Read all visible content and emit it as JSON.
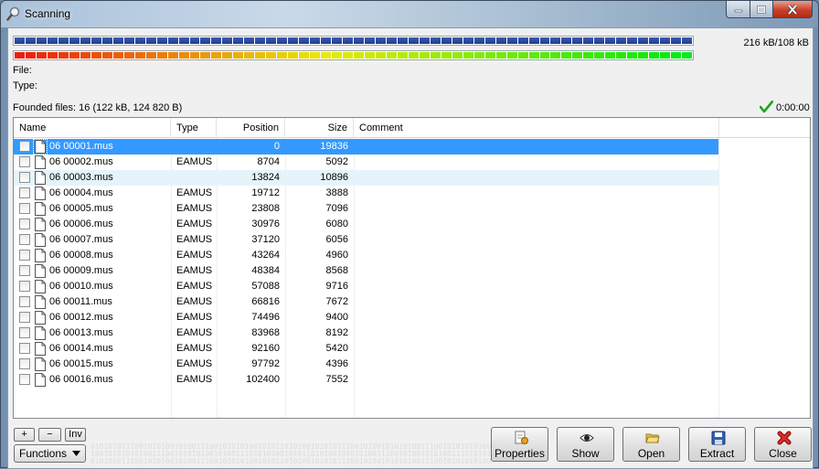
{
  "window": {
    "title": "Scanning"
  },
  "progress": {
    "text": "216 kB/108 kB",
    "fraction": 1.0
  },
  "labels": {
    "file": "File:",
    "type": "Type:"
  },
  "summary": {
    "found": "Founded files: 16 (122 kB, 124 820 B)",
    "elapsed": "0:00:00"
  },
  "table": {
    "columns": [
      "Name",
      "Type",
      "Position",
      "Size",
      "Comment"
    ],
    "rows": [
      {
        "name": "06 00001.mus",
        "type": "",
        "position": "0",
        "size": "19836"
      },
      {
        "name": "06 00002.mus",
        "type": "EAMUS",
        "position": "8704",
        "size": "5092"
      },
      {
        "name": "06 00003.mus",
        "type": "",
        "position": "13824",
        "size": "10896"
      },
      {
        "name": "06 00004.mus",
        "type": "EAMUS",
        "position": "19712",
        "size": "3888"
      },
      {
        "name": "06 00005.mus",
        "type": "EAMUS",
        "position": "23808",
        "size": "7096"
      },
      {
        "name": "06 00006.mus",
        "type": "EAMUS",
        "position": "30976",
        "size": "6080"
      },
      {
        "name": "06 00007.mus",
        "type": "EAMUS",
        "position": "37120",
        "size": "6056"
      },
      {
        "name": "06 00008.mus",
        "type": "EAMUS",
        "position": "43264",
        "size": "4960"
      },
      {
        "name": "06 00009.mus",
        "type": "EAMUS",
        "position": "48384",
        "size": "8568"
      },
      {
        "name": "06 00010.mus",
        "type": "EAMUS",
        "position": "57088",
        "size": "9716"
      },
      {
        "name": "06 00011.mus",
        "type": "EAMUS",
        "position": "66816",
        "size": "7672"
      },
      {
        "name": "06 00012.mus",
        "type": "EAMUS",
        "position": "74496",
        "size": "9400"
      },
      {
        "name": "06 00013.mus",
        "type": "EAMUS",
        "position": "83968",
        "size": "8192"
      },
      {
        "name": "06 00014.mus",
        "type": "EAMUS",
        "position": "92160",
        "size": "5420"
      },
      {
        "name": "06 00015.mus",
        "type": "EAMUS",
        "position": "97792",
        "size": "4396"
      },
      {
        "name": "06 00016.mus",
        "type": "EAMUS",
        "position": "102400",
        "size": "7552"
      }
    ]
  },
  "buttons": {
    "plus": "+",
    "minus": "−",
    "inv": "Inv",
    "functions": "Functions",
    "properties": "Properties",
    "show": "Show",
    "open": "Open",
    "extract": "Extract",
    "close": "Close"
  },
  "colors": {
    "selection": "#3399ff",
    "hover": "#e5f3fb",
    "blue_segments": "#1f3d8a"
  },
  "binary_pattern": "01010101110010101001010011100101010100101011010100101010111001010010101010011100101010101001",
  "icons": [
    "search-icon",
    "checkmark-icon",
    "file-icon",
    "properties-icon",
    "eye-icon",
    "folder-icon",
    "save-icon",
    "close-x-icon",
    "chevron-down-icon"
  ]
}
